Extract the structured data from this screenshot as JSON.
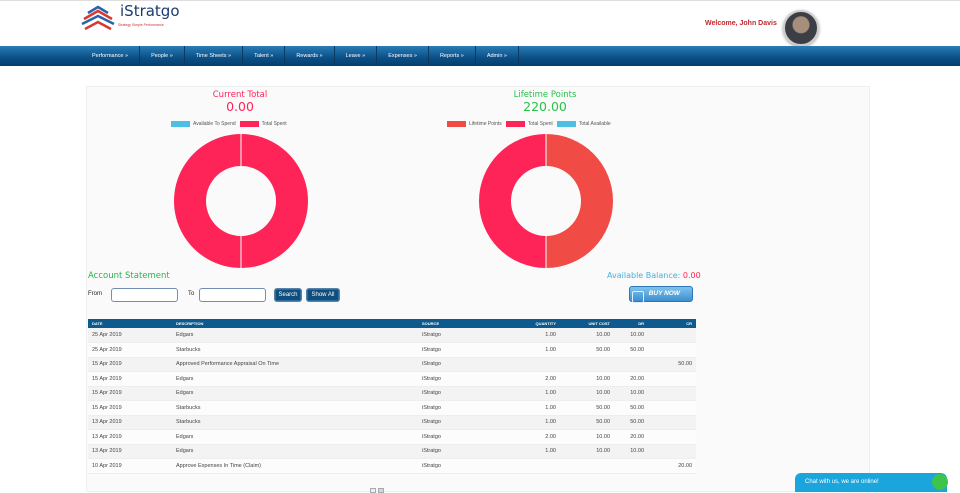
{
  "brand": {
    "name": "iStratgo",
    "tagline": "Strategy Simple Performance"
  },
  "header": {
    "welcome": "Welcome, John Davis"
  },
  "nav": [
    "Performance »",
    "People »",
    "Time Sheets »",
    "Talent »",
    "Rewards »",
    "Leave »",
    "Expenses »",
    "Reports »",
    "Admin »"
  ],
  "current_total": {
    "label": "Current Total",
    "value": "0.00",
    "legend": [
      {
        "name": "Available To Spend",
        "color": "#4dbfe3"
      },
      {
        "name": "Total Spent",
        "color": "#ff2457"
      }
    ]
  },
  "lifetime": {
    "label": "Lifetime Points",
    "value": "220.00",
    "legend": [
      {
        "name": "Lifetime Points",
        "color": "#f14b45"
      },
      {
        "name": "Total Spent",
        "color": "#ff2457"
      },
      {
        "name": "Total Available",
        "color": "#4dbfe3"
      }
    ]
  },
  "chart_data": [
    {
      "type": "pie",
      "title": "Current Total",
      "slices": [
        {
          "name": "Available To Spend",
          "value": 0
        },
        {
          "name": "Total Spent",
          "value": 1
        }
      ]
    },
    {
      "type": "pie",
      "title": "Lifetime Points",
      "slices": [
        {
          "name": "Lifetime Points",
          "value": 220
        },
        {
          "name": "Total Spent",
          "value": 220
        },
        {
          "name": "Total Available",
          "value": 0
        }
      ]
    }
  ],
  "statement": {
    "title": "Account Statement",
    "available_label": "Available Balance:",
    "available_value": "0.00",
    "from_label": "From",
    "to_label": "To",
    "search_label": "Search",
    "show_all_label": "Show All",
    "buy_now_label": "BUY NOW",
    "columns": [
      "DATE",
      "DESCRIPTION",
      "SOURCE",
      "QUANTITY",
      "UNIT COST",
      "DR",
      "CR"
    ],
    "rows": [
      [
        "25 Apr 2019",
        "Edgars",
        "iStratgo",
        "1.00",
        "10.00",
        "10.00",
        ""
      ],
      [
        "25 Apr 2019",
        "Starbucks",
        "iStratgo",
        "1.00",
        "50.00",
        "50.00",
        ""
      ],
      [
        "15 Apr 2019",
        "Approved Performance Appraisal On Time",
        "iStratgo",
        "",
        "",
        "",
        "50.00"
      ],
      [
        "15 Apr 2019",
        "Edgars",
        "iStratgo",
        "2.00",
        "10.00",
        "20.00",
        ""
      ],
      [
        "15 Apr 2019",
        "Edgars",
        "iStratgo",
        "1.00",
        "10.00",
        "10.00",
        ""
      ],
      [
        "15 Apr 2019",
        "Starbucks",
        "iStratgo",
        "1.00",
        "50.00",
        "50.00",
        ""
      ],
      [
        "13 Apr 2019",
        "Starbucks",
        "iStratgo",
        "1.00",
        "50.00",
        "50.00",
        ""
      ],
      [
        "13 Apr 2019",
        "Edgars",
        "iStratgo",
        "2.00",
        "10.00",
        "20.00",
        ""
      ],
      [
        "13 Apr 2019",
        "Edgars",
        "iStratgo",
        "1.00",
        "10.00",
        "10.00",
        ""
      ],
      [
        "10 Apr 2019",
        "Approve Expenses In Time (Claim)",
        "iStratgo",
        "",
        "",
        "",
        "20.00"
      ]
    ]
  },
  "chat": {
    "label": "Chat with us, we are online!"
  }
}
